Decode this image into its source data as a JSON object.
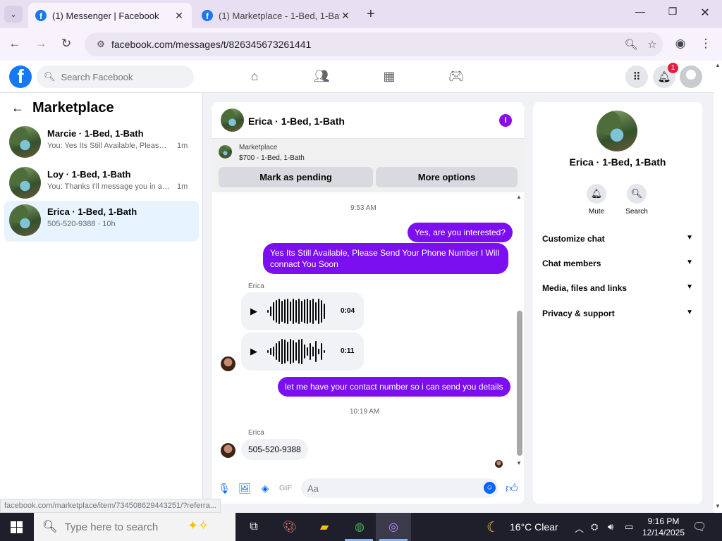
{
  "browser": {
    "tabs": [
      {
        "title": "(1) Messenger | Facebook",
        "active": true
      },
      {
        "title": "(1) Marketplace - 1-Bed, 1-Bath",
        "active": false
      }
    ],
    "url": "facebook.com/messages/t/826345673261441",
    "status_url": "facebook.com/marketplace/item/734508629443251/?referra..."
  },
  "fb_header": {
    "search_placeholder": "Search Facebook",
    "notification_count": "1"
  },
  "left_panel": {
    "title": "Marketplace",
    "conversations": [
      {
        "name": "Marcie · 1-Bed, 1-Bath",
        "snippet": "You: Yes Its Still Available, Please Sen...",
        "time": "1m",
        "selected": false
      },
      {
        "name": "Loy · 1-Bed, 1-Bath",
        "snippet": "You: Thanks I'll message you in a mo...",
        "time": "1m",
        "selected": false
      },
      {
        "name": "Erica · 1-Bed, 1-Bath",
        "snippet": "505-520-9388 · 10h",
        "time": "",
        "selected": true
      }
    ]
  },
  "chat": {
    "header_name": "Erica · 1-Bed, 1-Bath",
    "marketplace_label": "Marketplace",
    "listing": "$700 - 1-Bed, 1-Bath",
    "mark_pending_label": "Mark as pending",
    "more_options_label": "More options",
    "timestamp_1": "9:53 AM",
    "msg_out_1": "Yes, are you interested?",
    "msg_out_2_line1": "Yes Its Still Available, Please Send Your Phone Number I Will",
    "msg_out_2_line2": "connact You Soon",
    "sender_1": "Erica",
    "audio_1_duration": "0:04",
    "audio_2_duration": "0:11",
    "msg_out_3": "let me have your contact number so i can send you details",
    "timestamp_2": "10:19 AM",
    "sender_2": "Erica",
    "msg_in_1": "505-520-9388",
    "composer_placeholder": "Aa"
  },
  "right_panel": {
    "name": "Erica · 1-Bed, 1-Bath",
    "mute_label": "Mute",
    "search_label": "Search",
    "sections": [
      "Customize chat",
      "Chat members",
      "Media, files and links",
      "Privacy & support"
    ]
  },
  "taskbar": {
    "search_placeholder": "Type here to search",
    "weather": "16°C  Clear",
    "time": "9:16 PM",
    "date": "12/14/2025"
  },
  "colors": {
    "fb_blue": "#1877f2",
    "messenger_purple": "#7c0ff0",
    "selected_row": "#e7f3ff",
    "notification_red": "#e41e3f"
  }
}
